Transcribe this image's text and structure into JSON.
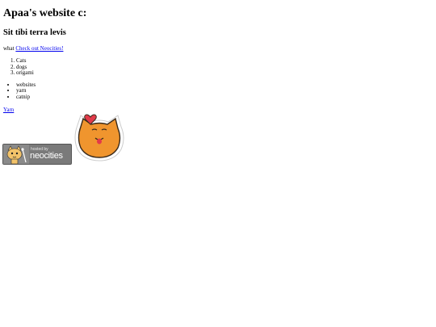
{
  "page": {
    "heading": "Apaa's website c:",
    "subheading": "Sit tibi terra levis",
    "intro_text": "what",
    "intro_link": "Check out Neocities!",
    "ordered_list": [
      "Cats",
      "dogs",
      "origami"
    ],
    "unordered_list": [
      "websites",
      "yarn",
      "catnip"
    ],
    "yarn_link": "Yarn"
  },
  "badge": {
    "hosted_text": "hosted by",
    "brand_text": "neocities"
  },
  "colors": {
    "link": "#0000ee",
    "badge_bg": "#7a7a7a",
    "cat_orange": "#f0952e",
    "heart": "#e23a4a"
  },
  "icons": {
    "sticker": "orange-cat-heart-icon",
    "badge_mascot": "neocities-cat-icon"
  }
}
